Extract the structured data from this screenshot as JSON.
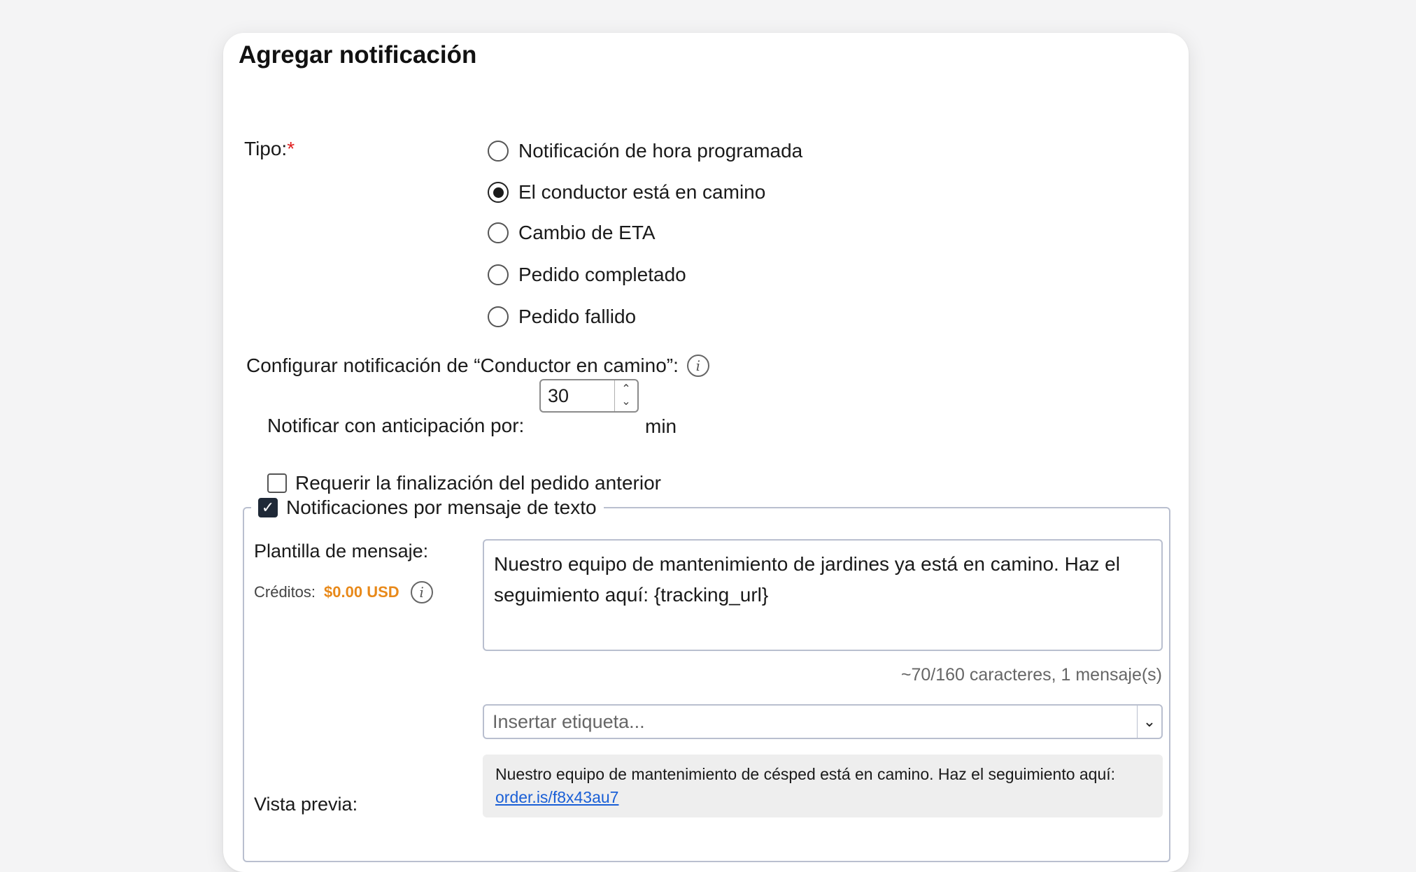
{
  "form": {
    "title": "Agregar notificación",
    "type_label": "Tipo:",
    "required_mark": "*",
    "type_options": [
      {
        "label": "Notificación de hora programada",
        "selected": false
      },
      {
        "label": "El conductor está en camino",
        "selected": true
      },
      {
        "label": "Cambio de ETA",
        "selected": false
      },
      {
        "label": "Pedido completado",
        "selected": false
      },
      {
        "label": "Pedido fallido",
        "selected": false
      }
    ],
    "config_label": "Configurar notificación de “Conductor en camino”:",
    "advance_label": "Notificar con anticipación por:",
    "advance_value": "30",
    "advance_unit": "min",
    "require_previous_label": "Requerir la finalización del pedido anterior",
    "require_previous_checked": false
  },
  "sms": {
    "enabled": true,
    "legend": "Notificaciones por mensaje de texto",
    "template_label": "Plantilla de mensaje:",
    "credits_label": "Créditos:",
    "credits_amount": "$0.00 USD",
    "template_text": "Nuestro equipo de mantenimiento de jardines ya está en camino. Haz el seguimiento aquí: {tracking_url}",
    "char_count": "~70/160 caracteres, 1 mensaje(s)",
    "insert_tag_placeholder": "Insertar etiqueta...",
    "preview_label": "Vista previa:",
    "preview_text": "Nuestro equipo de mantenimiento de césped está en camino. Haz el seguimiento aquí:",
    "preview_link": "order.is/f8x43au7"
  },
  "colors": {
    "accent_orange": "#e8891a",
    "link_blue": "#1a5fd6",
    "required_red": "#e02020"
  }
}
